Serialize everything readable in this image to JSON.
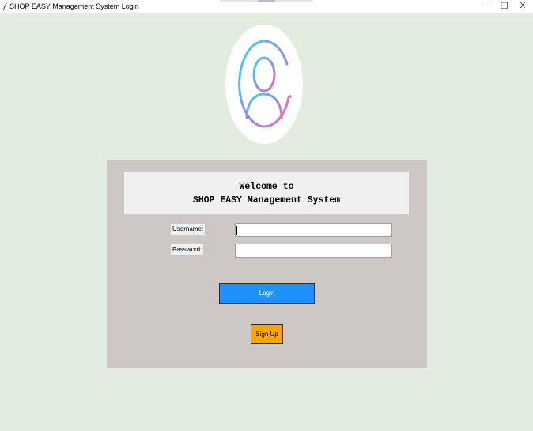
{
  "window": {
    "title": "SHOP EASY Management System Login",
    "minimize_glyph": "−",
    "maximize_glyph": "❐",
    "close_glyph": "X"
  },
  "avatar": {
    "icon": "user-avatar-icon"
  },
  "welcome": {
    "line1": "Welcome to",
    "line2": "SHOP EASY Management System"
  },
  "form": {
    "username_label": "Username:",
    "password_label": "Password:",
    "username_value": "",
    "password_value": ""
  },
  "buttons": {
    "login_label": "Login",
    "signup_label": "Sign Up"
  },
  "colors": {
    "background": "#e2ecdf",
    "panel": "#cdc8c5",
    "login_button": "#1e90ff",
    "signup_button": "#ffa500"
  }
}
